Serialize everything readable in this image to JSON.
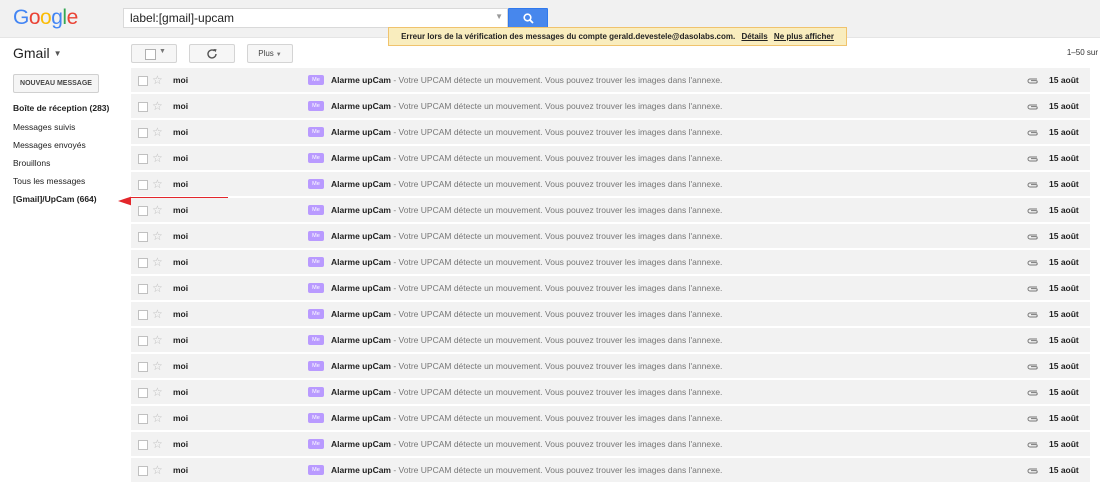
{
  "header": {
    "logo": "Google",
    "search_value": "label:[gmail]-upcam",
    "search_icon": "search-icon"
  },
  "toolbar": {
    "app_label": "Gmail",
    "more_label": "Plus",
    "page_range": "1–50 sur"
  },
  "banner": {
    "message": "Erreur lors de la vérification des messages du compte gerald.devestele@dasolabs.com.",
    "details_link": "Détails",
    "dismiss_link": "Ne plus afficher",
    "color": "#f9edbe"
  },
  "sidebar": {
    "compose_label": "NOUVEAU MESSAGE",
    "items": [
      {
        "label": "Boîte de réception (283)",
        "bold": true
      },
      {
        "label": "Messages suivis",
        "bold": false
      },
      {
        "label": "Messages envoyés",
        "bold": false
      },
      {
        "label": "Brouillons",
        "bold": false
      },
      {
        "label": "Tous les messages",
        "bold": false
      },
      {
        "label": "[Gmail]/UpCam (664)",
        "bold": true
      }
    ]
  },
  "annotation": {
    "arrow_color": "#e3262b"
  },
  "messages": [
    {
      "sender": "moi",
      "tag": "Me",
      "subject": "Alarme upCam",
      "snippet": " - Votre UPCAM détecte un mouvement. Vous pouvez trouver les images dans l'annexe.",
      "date": "15 août"
    },
    {
      "sender": "moi",
      "tag": "Me",
      "subject": "Alarme upCam",
      "snippet": " - Votre UPCAM détecte un mouvement. Vous pouvez trouver les images dans l'annexe.",
      "date": "15 août"
    },
    {
      "sender": "moi",
      "tag": "Me",
      "subject": "Alarme upCam",
      "snippet": " - Votre UPCAM détecte un mouvement. Vous pouvez trouver les images dans l'annexe.",
      "date": "15 août"
    },
    {
      "sender": "moi",
      "tag": "Me",
      "subject": "Alarme upCam",
      "snippet": " - Votre UPCAM détecte un mouvement. Vous pouvez trouver les images dans l'annexe.",
      "date": "15 août"
    },
    {
      "sender": "moi",
      "tag": "Me",
      "subject": "Alarme upCam",
      "snippet": " - Votre UPCAM détecte un mouvement. Vous pouvez trouver les images dans l'annexe.",
      "date": "15 août"
    },
    {
      "sender": "moi",
      "tag": "Me",
      "subject": "Alarme upCam",
      "snippet": " - Votre UPCAM détecte un mouvement. Vous pouvez trouver les images dans l'annexe.",
      "date": "15 août"
    },
    {
      "sender": "moi",
      "tag": "Me",
      "subject": "Alarme upCam",
      "snippet": " - Votre UPCAM détecte un mouvement. Vous pouvez trouver les images dans l'annexe.",
      "date": "15 août"
    },
    {
      "sender": "moi",
      "tag": "Me",
      "subject": "Alarme upCam",
      "snippet": " - Votre UPCAM détecte un mouvement. Vous pouvez trouver les images dans l'annexe.",
      "date": "15 août"
    },
    {
      "sender": "moi",
      "tag": "Me",
      "subject": "Alarme upCam",
      "snippet": " - Votre UPCAM détecte un mouvement. Vous pouvez trouver les images dans l'annexe.",
      "date": "15 août"
    },
    {
      "sender": "moi",
      "tag": "Me",
      "subject": "Alarme upCam",
      "snippet": " - Votre UPCAM détecte un mouvement. Vous pouvez trouver les images dans l'annexe.",
      "date": "15 août"
    },
    {
      "sender": "moi",
      "tag": "Me",
      "subject": "Alarme upCam",
      "snippet": " - Votre UPCAM détecte un mouvement. Vous pouvez trouver les images dans l'annexe.",
      "date": "15 août"
    },
    {
      "sender": "moi",
      "tag": "Me",
      "subject": "Alarme upCam",
      "snippet": " - Votre UPCAM détecte un mouvement. Vous pouvez trouver les images dans l'annexe.",
      "date": "15 août"
    },
    {
      "sender": "moi",
      "tag": "Me",
      "subject": "Alarme upCam",
      "snippet": " - Votre UPCAM détecte un mouvement. Vous pouvez trouver les images dans l'annexe.",
      "date": "15 août"
    },
    {
      "sender": "moi",
      "tag": "Me",
      "subject": "Alarme upCam",
      "snippet": " - Votre UPCAM détecte un mouvement. Vous pouvez trouver les images dans l'annexe.",
      "date": "15 août"
    },
    {
      "sender": "moi",
      "tag": "Me",
      "subject": "Alarme upCam",
      "snippet": " - Votre UPCAM détecte un mouvement. Vous pouvez trouver les images dans l'annexe.",
      "date": "15 août"
    },
    {
      "sender": "moi",
      "tag": "Me",
      "subject": "Alarme upCam",
      "snippet": " - Votre UPCAM détecte un mouvement. Vous pouvez trouver les images dans l'annexe.",
      "date": "15 août"
    }
  ]
}
